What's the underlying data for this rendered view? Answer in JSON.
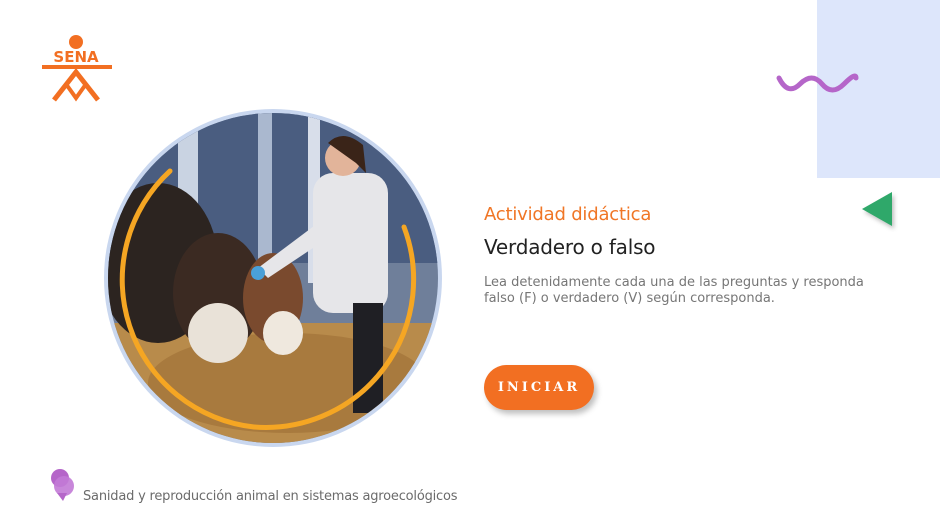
{
  "brand": {
    "logo_text": "SENA",
    "color": "#f26f22"
  },
  "activity": {
    "subtitle": "Actividad didáctica",
    "title": "Verdadero o falso",
    "description": "Lea detenidamente cada una de las preguntas y responda falso (F) o verdadero (V) según corresponda."
  },
  "start_button": {
    "label": "INICIAR"
  },
  "footer": {
    "course": "Sanidad y reproducción animal en sistemas agroecológicos"
  },
  "colors": {
    "accent_orange": "#f07626",
    "panel_blue": "#dde6fb",
    "wave_purple": "#b566c9",
    "triangle_green": "#2fa86a"
  },
  "icons": {
    "logo": "sena-logo-icon",
    "wave": "wave-icon",
    "triangle": "triangle-left-icon",
    "footer": "course-bubble-icon"
  }
}
